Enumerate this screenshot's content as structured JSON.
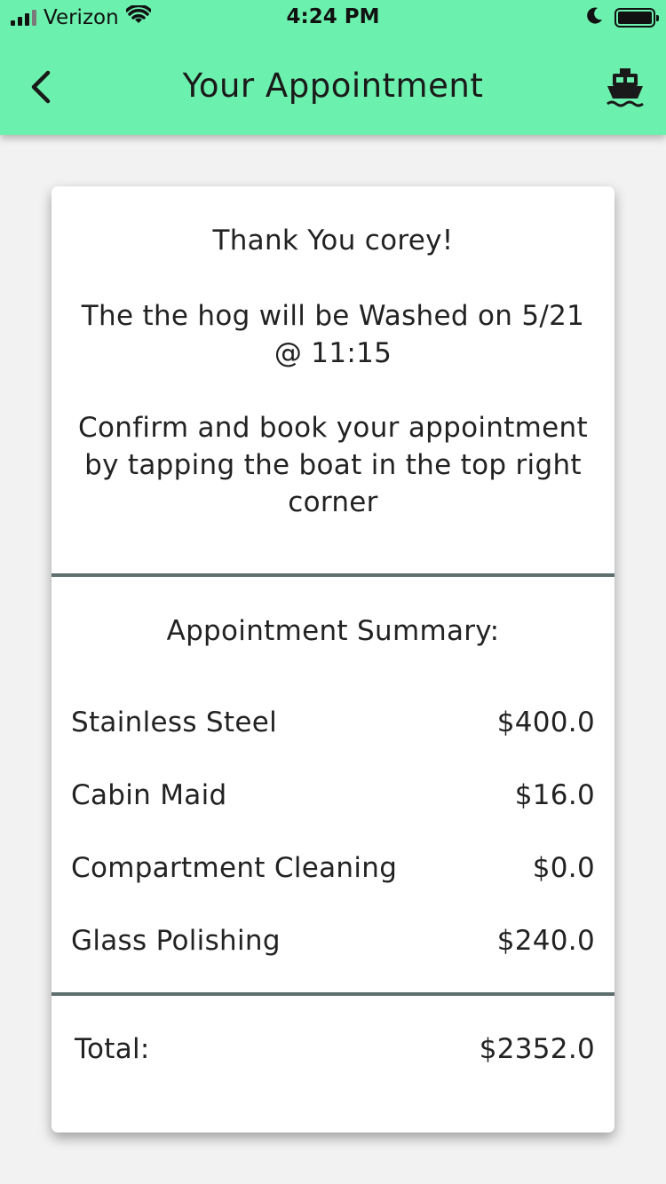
{
  "status_bar": {
    "carrier": "Verizon",
    "time": "4:24 PM",
    "icons": [
      "signal-icon",
      "wifi-icon",
      "moon-icon",
      "battery-icon"
    ]
  },
  "header": {
    "title": "Your Appointment",
    "back_icon": "chevron-left-icon",
    "action_icon": "boat-icon",
    "background_color": "#6cf0ad"
  },
  "message": {
    "thank_you": "Thank You corey!",
    "wash_line1": "The the hog will be Washed on 5/21",
    "wash_line2": "@ 11:15",
    "confirm_line1": "Confirm and book your appointment",
    "confirm_line2": "by tapping the boat in the top right",
    "confirm_line3": "corner"
  },
  "summary": {
    "title": "Appointment Summary:",
    "items": [
      {
        "name": "Stainless Steel",
        "price": "$400.0"
      },
      {
        "name": "Cabin Maid",
        "price": "$16.0"
      },
      {
        "name": "Compartment Cleaning",
        "price": "$0.0"
      },
      {
        "name": "Glass Polishing",
        "price": "$240.0"
      }
    ],
    "total_label": "Total:",
    "total_value": "$2352.0"
  }
}
